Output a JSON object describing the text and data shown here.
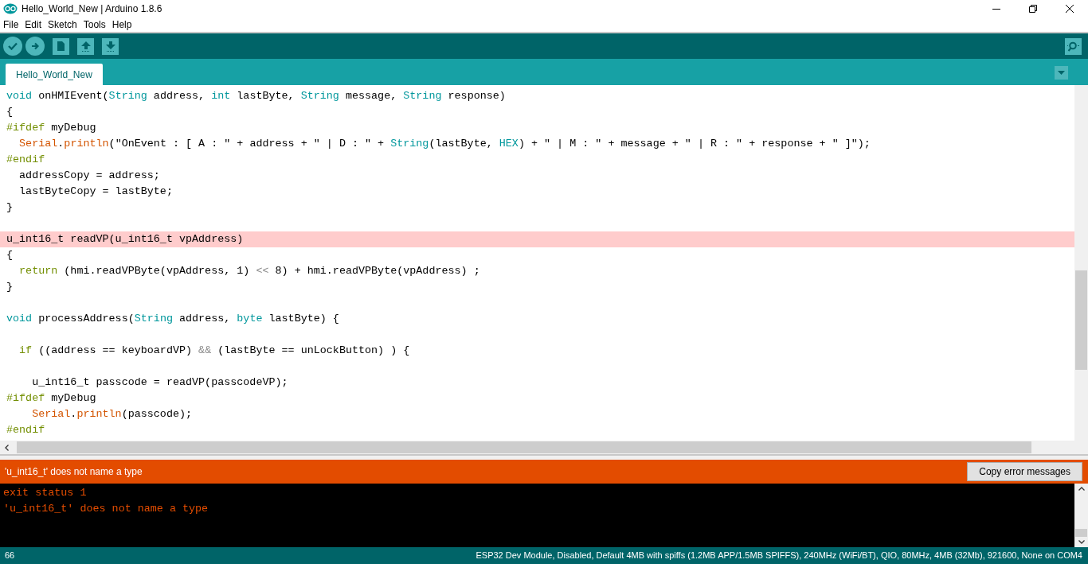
{
  "window": {
    "title": "Hello_World_New | Arduino 1.8.6"
  },
  "menu": [
    "File",
    "Edit",
    "Sketch",
    "Tools",
    "Help"
  ],
  "tabs": [
    {
      "label": "Hello_World_New",
      "selected": true
    }
  ],
  "editor": {
    "lines": [
      {
        "highlighted": false,
        "tokens": [
          {
            "kind": "type",
            "text": "void"
          },
          {
            "kind": "plain",
            "text": " onHMIEvent("
          },
          {
            "kind": "type",
            "text": "String"
          },
          {
            "kind": "plain",
            "text": " address, "
          },
          {
            "kind": "type",
            "text": "int"
          },
          {
            "kind": "plain",
            "text": " lastByte, "
          },
          {
            "kind": "type",
            "text": "String"
          },
          {
            "kind": "plain",
            "text": " message, "
          },
          {
            "kind": "type",
            "text": "String"
          },
          {
            "kind": "plain",
            "text": " response)"
          }
        ]
      },
      {
        "highlighted": false,
        "tokens": [
          {
            "kind": "plain",
            "text": "{"
          }
        ]
      },
      {
        "highlighted": false,
        "tokens": [
          {
            "kind": "keyword",
            "text": "#ifdef"
          },
          {
            "kind": "plain",
            "text": " myDebug"
          }
        ]
      },
      {
        "highlighted": false,
        "tokens": [
          {
            "kind": "function",
            "text": "  Serial"
          },
          {
            "kind": "plain",
            "text": "."
          },
          {
            "kind": "function",
            "text": "println"
          },
          {
            "kind": "plain",
            "text": "(\"OnEvent : [ A : \" + address + \" | D : \" + "
          },
          {
            "kind": "type",
            "text": "String"
          },
          {
            "kind": "plain",
            "text": "(lastByte, "
          },
          {
            "kind": "type",
            "text": "HEX"
          },
          {
            "kind": "plain",
            "text": ") + \" | M : \" + message + \" | R : \" + response + \" ]\");"
          }
        ]
      },
      {
        "highlighted": false,
        "tokens": [
          {
            "kind": "keyword",
            "text": "#endif"
          }
        ]
      },
      {
        "highlighted": false,
        "tokens": [
          {
            "kind": "plain",
            "text": "  addressCopy = address;"
          }
        ]
      },
      {
        "highlighted": false,
        "tokens": [
          {
            "kind": "plain",
            "text": "  lastByteCopy = lastByte;"
          }
        ]
      },
      {
        "highlighted": false,
        "tokens": [
          {
            "kind": "plain",
            "text": "}"
          }
        ]
      },
      {
        "kind": "blank"
      },
      {
        "highlighted": true,
        "tokens": [
          {
            "kind": "plain",
            "text": "u_int16_t readVP(u_int16_t vpAddress)"
          }
        ]
      },
      {
        "highlighted": false,
        "tokens": [
          {
            "kind": "plain",
            "text": "{"
          }
        ]
      },
      {
        "highlighted": false,
        "tokens": [
          {
            "kind": "keyword",
            "text": "  return"
          },
          {
            "kind": "plain",
            "text": " (hmi.readVPByte(vpAddress, 1) "
          },
          {
            "kind": "operator",
            "text": "<<"
          },
          {
            "kind": "plain",
            "text": " 8) + hmi.readVPByte(vpAddress) ;"
          }
        ]
      },
      {
        "highlighted": false,
        "tokens": [
          {
            "kind": "plain",
            "text": "}"
          }
        ]
      },
      {
        "kind": "blank"
      },
      {
        "highlighted": false,
        "tokens": [
          {
            "kind": "type",
            "text": "void"
          },
          {
            "kind": "plain",
            "text": " processAddress("
          },
          {
            "kind": "type",
            "text": "String"
          },
          {
            "kind": "plain",
            "text": " address, "
          },
          {
            "kind": "type",
            "text": "byte"
          },
          {
            "kind": "plain",
            "text": " lastByte) {"
          }
        ]
      },
      {
        "kind": "blank"
      },
      {
        "highlighted": false,
        "tokens": [
          {
            "kind": "keyword",
            "text": "  if"
          },
          {
            "kind": "plain",
            "text": " ((address == keyboardVP) "
          },
          {
            "kind": "operator",
            "text": "&&"
          },
          {
            "kind": "plain",
            "text": " (lastByte == unLockButton) ) {"
          }
        ]
      },
      {
        "kind": "blank"
      },
      {
        "highlighted": false,
        "tokens": [
          {
            "kind": "plain",
            "text": "    u_int16_t passcode = readVP(passcodeVP);"
          }
        ]
      },
      {
        "highlighted": false,
        "tokens": [
          {
            "kind": "keyword",
            "text": "#ifdef"
          },
          {
            "kind": "plain",
            "text": " myDebug"
          }
        ]
      },
      {
        "highlighted": false,
        "tokens": [
          {
            "kind": "function",
            "text": "    Serial"
          },
          {
            "kind": "plain",
            "text": "."
          },
          {
            "kind": "function",
            "text": "println"
          },
          {
            "kind": "plain",
            "text": "(passcode);"
          }
        ]
      },
      {
        "highlighted": false,
        "tokens": [
          {
            "kind": "keyword",
            "text": "#endif"
          }
        ]
      }
    ]
  },
  "error_bar": {
    "message": "'u_int16_t' does not name a type",
    "button": "Copy error messages"
  },
  "console": {
    "lines": [
      "exit status 1",
      "'u_int16_t' does not name a type"
    ]
  },
  "status_bar": {
    "line": "66",
    "board": "ESP32 Dev Module, Disabled, Default 4MB with spiffs (1.2MB APP/1.5MB SPIFFS), 240MHz (WiFi/BT), QIO, 80MHz, 4MB (32Mb), 921600, None on COM4"
  }
}
